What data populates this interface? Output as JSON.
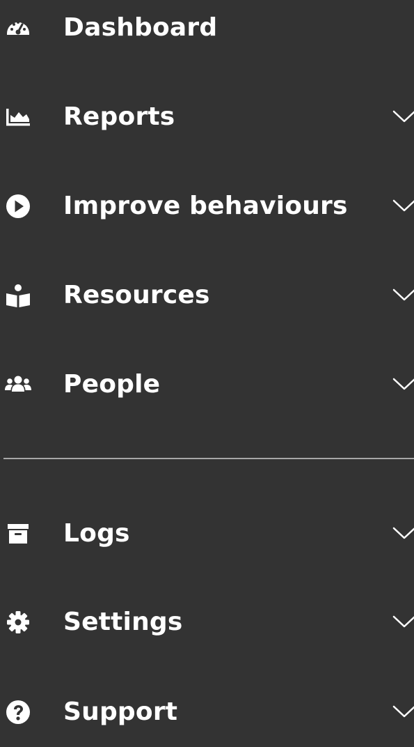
{
  "theme": {
    "background": "#333333",
    "text": "#ffffff",
    "divider": "#a8a8a8"
  },
  "nav": {
    "primary": [
      {
        "label": "Dashboard",
        "icon": "dashboard-gauge-icon",
        "has_submenu": false
      },
      {
        "label": "Reports",
        "icon": "area-chart-icon",
        "has_submenu": true
      },
      {
        "label": "Improve behaviours",
        "icon": "play-circle-icon",
        "has_submenu": true
      },
      {
        "label": "Resources",
        "icon": "reader-book-icon",
        "has_submenu": true
      },
      {
        "label": "People",
        "icon": "users-group-icon",
        "has_submenu": true
      }
    ],
    "secondary": [
      {
        "label": "Logs",
        "icon": "archive-box-icon",
        "has_submenu": true
      },
      {
        "label": "Settings",
        "icon": "gear-icon",
        "has_submenu": true
      },
      {
        "label": "Support",
        "icon": "question-circle-icon",
        "has_submenu": true
      }
    ]
  }
}
